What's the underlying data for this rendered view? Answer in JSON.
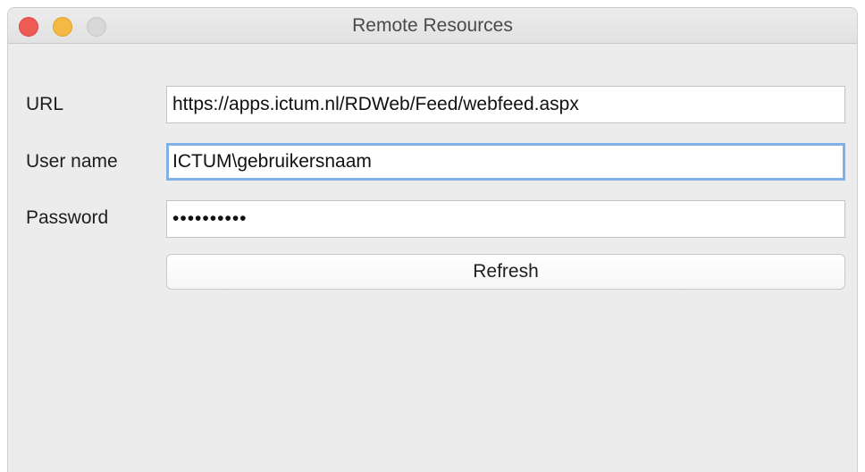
{
  "window": {
    "title": "Remote Resources"
  },
  "form": {
    "url": {
      "label": "URL",
      "value": "https://apps.ictum.nl/RDWeb/Feed/webfeed.aspx"
    },
    "username": {
      "label": "User name",
      "value": "ICTUM\\gebruikersnaam"
    },
    "password": {
      "label": "Password",
      "masked_value": "••••••••••"
    },
    "refresh_label": "Refresh"
  },
  "colors": {
    "window_background": "#ececec",
    "focus_ring": "#7fb0e8",
    "close_button": "#ee5b55",
    "minimize_button": "#f3b943",
    "zoom_button_inactive": "#d8d8d8"
  }
}
